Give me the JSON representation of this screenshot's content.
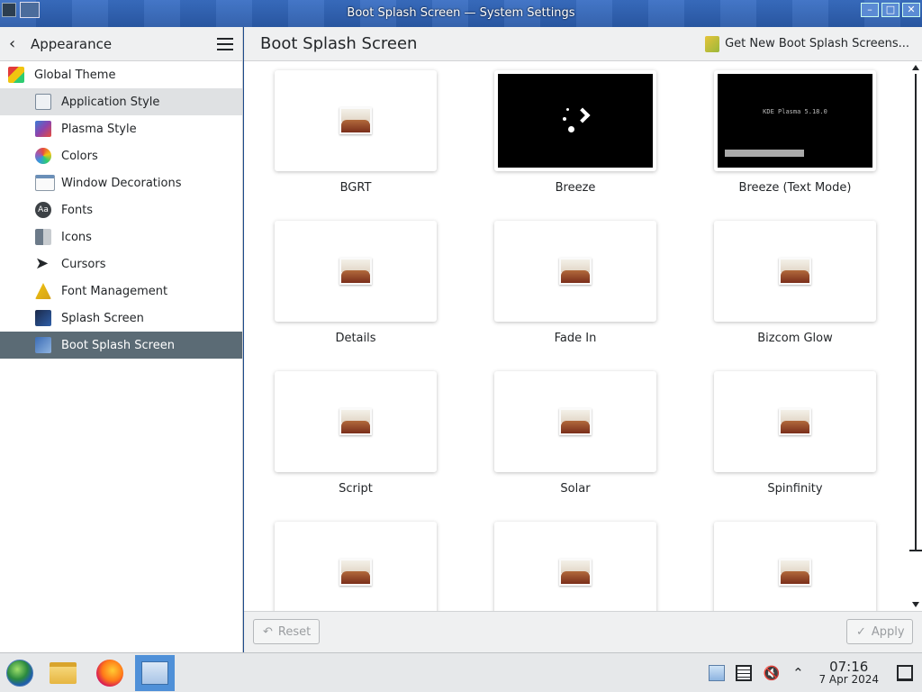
{
  "window": {
    "title": "Boot Splash Screen — System Settings"
  },
  "sidebar": {
    "title": "Appearance",
    "items": [
      {
        "label": "Global Theme"
      },
      {
        "label": "Application Style"
      },
      {
        "label": "Plasma Style"
      },
      {
        "label": "Colors"
      },
      {
        "label": "Window Decorations"
      },
      {
        "label": "Fonts"
      },
      {
        "label": "Icons"
      },
      {
        "label": "Cursors"
      },
      {
        "label": "Font Management"
      },
      {
        "label": "Splash Screen"
      },
      {
        "label": "Boot Splash Screen"
      }
    ]
  },
  "main": {
    "title": "Boot Splash Screen",
    "get_new_label": "Get New Boot Splash Screens...",
    "themes": [
      {
        "name": "BGRT"
      },
      {
        "name": "Breeze"
      },
      {
        "name": "Breeze (Text Mode)",
        "preview_text": "KDE Plasma 5.18.0"
      },
      {
        "name": "Details"
      },
      {
        "name": "Fade In"
      },
      {
        "name": "Bizcom Glow"
      },
      {
        "name": "Script"
      },
      {
        "name": "Solar"
      },
      {
        "name": "Spinfinity"
      }
    ]
  },
  "footer": {
    "reset_label": "Reset",
    "apply_label": "Apply"
  },
  "taskbar": {
    "time": "07:16",
    "date": "7 Apr 2024"
  },
  "colors": {
    "selected": "#5b6b75",
    "hover": "#dfe1e3",
    "taskbar_active": "#4f90d8"
  }
}
